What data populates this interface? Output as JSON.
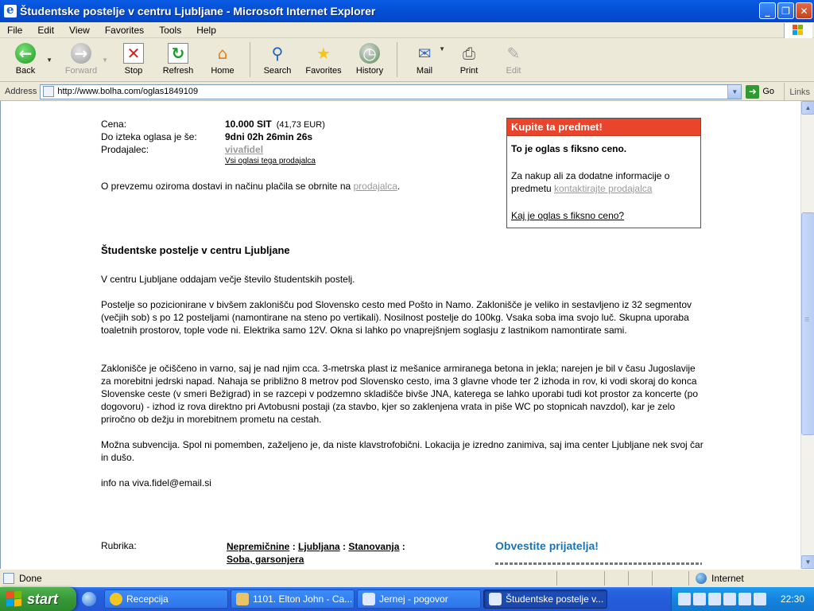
{
  "window": {
    "title": "Študentske postelje v centru Ljubljane - Microsoft Internet Explorer",
    "minimize": "_",
    "maximize": "❐",
    "close": "✕"
  },
  "menu": [
    "File",
    "Edit",
    "View",
    "Favorites",
    "Tools",
    "Help"
  ],
  "toolbar": {
    "back": "Back",
    "forward": "Forward",
    "stop": "Stop",
    "refresh": "Refresh",
    "home": "Home",
    "search": "Search",
    "favorites": "Favorites",
    "history": "History",
    "mail": "Mail",
    "print": "Print",
    "edit": "Edit"
  },
  "address": {
    "label": "Address",
    "url": "http://www.bolha.com/oglas1849109",
    "go": "Go",
    "links": "Links"
  },
  "page": {
    "details": {
      "price_label": "Cena:",
      "price": "10.000 SIT",
      "price_eur": "(41,73 EUR)",
      "expires_label": "Do izteka oglasa je še:",
      "expires": "9dni 02h 26min 26s",
      "seller_label": "Prodajalec:",
      "seller": "vivafidel",
      "seller_ads": "Vsi oglasi tega prodajalca",
      "contact_text": "O prevzemu oziroma dostavi in načinu plačila se obrnite na ",
      "contact_link": "prodajalca",
      "contact_end": "."
    },
    "buybox": {
      "header": "Kupite ta predmet!",
      "fixed": "To je oglas s fiksno ceno.",
      "info_text": "Za nakup ali za dodatne informacije o predmetu ",
      "info_link": "kontaktirajte prodajalca",
      "what_link": "Kaj je oglas s fiksno ceno?"
    },
    "ad": {
      "title": "Študentske postelje v centru Ljubljane",
      "p1": "V centru Ljubljane oddajam večje število študentskih postelj.",
      "p2": "Postelje so pozicionirane v bivšem zaklonišču pod Slovensko cesto med Pošto in Namo. Zaklonišče je veliko in sestavljeno iz 32 segmentov (večjih sob) s po 12 posteljami (namontirane na steno po vertikali). Nosilnost postelje do 100kg. Vsaka soba ima svojo luč. Skupna uporaba toaletnih prostorov, tople vode ni. Elektrika samo 12V. Okna si lahko po vnaprejšnjem soglasju z lastnikom namontirate sami.",
      "p3": "Zaklonišče je očiščeno in varno, saj je nad njim cca. 3-metrska plast iz mešanice armiranega betona in jekla; narejen je bil v času Jugoslavije za morebitni jedrski napad. Nahaja se približno 8 metrov pod Slovensko cesto, ima 3 glavne vhode ter 2 izhoda in rov, ki vodi skoraj do konca Slovenske ceste (v smeri Bežigrad) in se razcepi v podzemno skladišče bivše JNA, katerega se lahko uporabi tudi kot prostor za koncerte (po dogovoru) - izhod iz rova direktno pri Avtobusni postaji (za stavbo, kjer so zaklenjena vrata in piše WC po stopnicah navzdol), kar je zelo priročno ob dežju in morebitnem prometu na cestah.",
      "p4": "Možna subvencija. Spol ni pomemben, zaželjeno je, da niste klavstrofobični. Lokacija je izredno zanimiva, saj ima center Ljubljane nek svoj čar in dušo.",
      "p5": "info na viva.fidel@email.si"
    },
    "rubrika": {
      "label": "Rubrika:",
      "cat1": "Nepremičnine",
      "cat2": "Ljubljana",
      "cat3": "Stanovanja",
      "cat4": "Soba, garsonjera",
      "sep": " : "
    },
    "friend": "Obvestite prijatelja!"
  },
  "status": {
    "text": "Done",
    "zone": "Internet"
  },
  "taskbar": {
    "start": "start",
    "tasks": [
      "Recepcija",
      "1101. Elton John - Ca...",
      "Jernej - pogovor",
      "Študentske postelje v..."
    ],
    "clock": "22:30"
  }
}
